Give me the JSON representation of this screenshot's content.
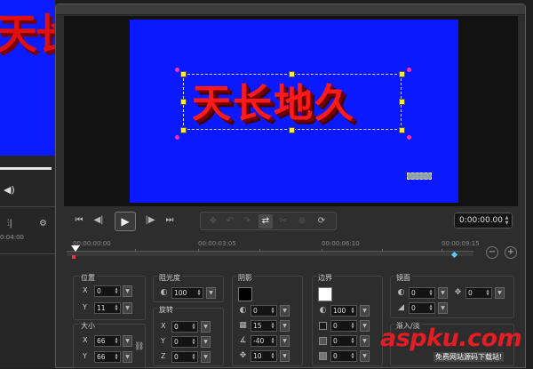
{
  "background_app": {
    "preview_title": "天长地久",
    "time": "0:04:00"
  },
  "preview": {
    "title_text": "天长地久",
    "canvas_color": "#0a19ff",
    "text_color": "#ff1a1a"
  },
  "transport": {
    "timecode": "0:00:00.00",
    "icons": [
      "go-start-icon",
      "step-back-icon",
      "play-icon",
      "step-forward-icon",
      "go-end-icon"
    ]
  },
  "ruler": {
    "labels": [
      "00:00:00:00",
      "00:00:03:05",
      "00:00:06:10",
      "00:00:09:15"
    ]
  },
  "properties": {
    "position": {
      "title": "位置",
      "x_label": "X",
      "x_value": "0",
      "y_label": "Y",
      "y_value": "11"
    },
    "opacity": {
      "title": "阻光度",
      "value": "100"
    },
    "rotation": {
      "title": "旋转",
      "x_label": "X",
      "x_value": "0",
      "y_label": "Y",
      "y_value": "0",
      "z_label": "Z",
      "z_value": "0"
    },
    "size": {
      "title": "大小",
      "x_label": "X",
      "x_value": "66",
      "y_label": "Y",
      "y_value": "66"
    },
    "shadow": {
      "title": "阴影",
      "color": "#000000",
      "opacity": "0",
      "size": "15",
      "angle": "-40",
      "distance": "10"
    },
    "border": {
      "title": "边界",
      "color": "#ffffff",
      "opacity": "100",
      "v2": "0",
      "v3": "0",
      "v4": "0"
    },
    "mirror": {
      "title": "镜面",
      "v1": "0",
      "v2": "0",
      "v3": "0"
    },
    "fade_in": {
      "title": "渐入/淡"
    }
  },
  "watermark": {
    "main": "aspku.com",
    "sub": "免费网站源码下载站!"
  }
}
